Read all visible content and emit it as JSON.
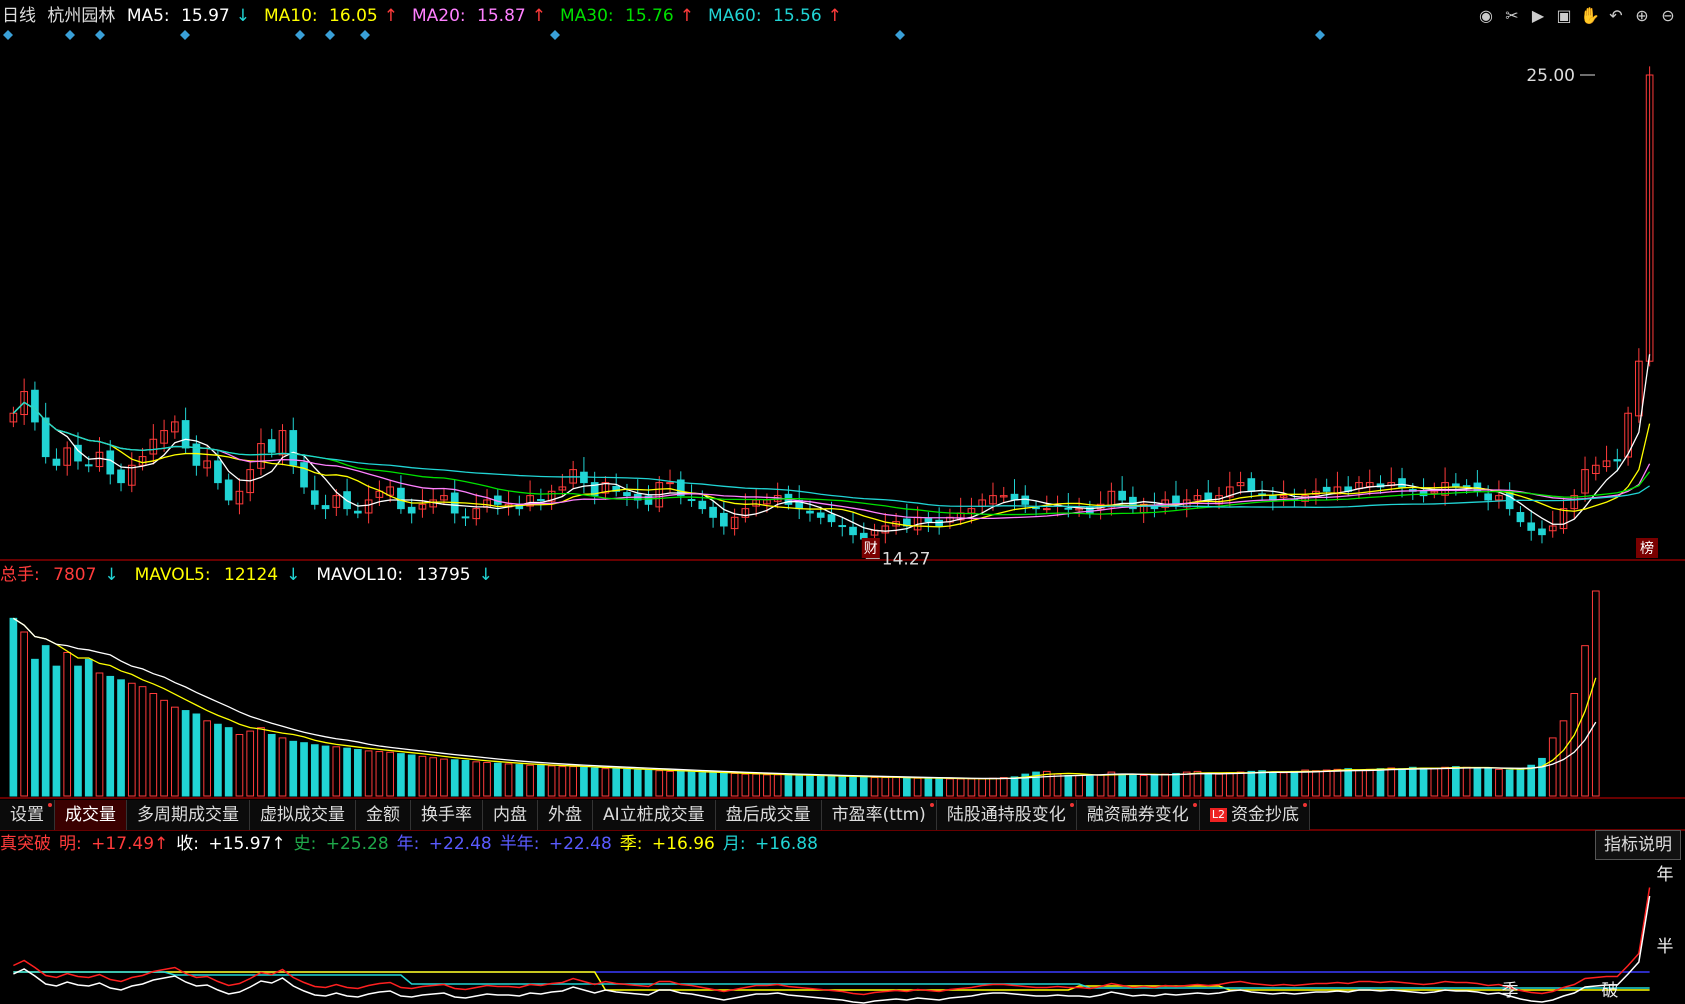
{
  "header": {
    "period": "日线",
    "stock_name": "杭州园林",
    "ma_items": [
      {
        "label": "MA5:",
        "value": "15.97",
        "arrow": "↓",
        "color": "#ffffff",
        "arrow_color": "#21d4d4"
      },
      {
        "label": "MA10:",
        "value": "16.05",
        "arrow": "↑",
        "color": "#ffff00",
        "arrow_color": "#ff3b3b"
      },
      {
        "label": "MA20:",
        "value": "15.87",
        "arrow": "↑",
        "color": "#ff80ff",
        "arrow_color": "#ff3b3b"
      },
      {
        "label": "MA30:",
        "value": "15.76",
        "arrow": "↑",
        "color": "#00e000",
        "arrow_color": "#ff3b3b"
      },
      {
        "label": "MA60:",
        "value": "15.56",
        "arrow": "↑",
        "color": "#21d4d4",
        "arrow_color": "#ff3b3b"
      }
    ]
  },
  "toolbar_icons": [
    "eye-icon",
    "scissors-icon",
    "play-icon",
    "lock-icon",
    "hand-icon",
    "undo-icon",
    "zoom-in-icon",
    "zoom-out-icon"
  ],
  "volume_legend": [
    {
      "label": "总手:",
      "value": "7807",
      "arrow": "↓",
      "color": "#ff3b3b"
    },
    {
      "label": "MAVOL5:",
      "value": "12124",
      "arrow": "↓",
      "color": "#ffff00"
    },
    {
      "label": "MAVOL10:",
      "value": "13795",
      "arrow": "↓",
      "color": "#ffffff"
    }
  ],
  "tabs": [
    {
      "label": "设置",
      "dot": true,
      "active": false
    },
    {
      "label": "成交量",
      "dot": false,
      "active": true
    },
    {
      "label": "多周期成交量",
      "dot": false,
      "active": false
    },
    {
      "label": "虚拟成交量",
      "dot": false,
      "active": false
    },
    {
      "label": "金额",
      "dot": false,
      "active": false
    },
    {
      "label": "换手率",
      "dot": false,
      "active": false
    },
    {
      "label": "内盘",
      "dot": false,
      "active": false
    },
    {
      "label": "外盘",
      "dot": false,
      "active": false
    },
    {
      "label": "AI立桩成交量",
      "dot": false,
      "active": false
    },
    {
      "label": "盘后成交量",
      "dot": false,
      "active": false
    },
    {
      "label": "市盈率(ttm)",
      "dot": true,
      "active": false
    },
    {
      "label": "陆股通持股变化",
      "dot": true,
      "active": false
    },
    {
      "label": "融资融券变化",
      "dot": true,
      "active": false
    },
    {
      "label": "资金抄底",
      "dot": true,
      "active": false,
      "badge": "L2"
    }
  ],
  "indicator_legend": [
    {
      "label": "真突破",
      "value": "",
      "color": "#ff3b3b"
    },
    {
      "label": "明:",
      "value": "+17.49↑",
      "color": "#ff3b3b"
    },
    {
      "label": "收:",
      "value": "+15.97↑",
      "color": "#ffffff"
    },
    {
      "label": "史:",
      "value": "+25.28",
      "color": "#1fa84a"
    },
    {
      "label": "年:",
      "value": "+22.48",
      "color": "#5a5aff"
    },
    {
      "label": "半年:",
      "value": "+22.48",
      "color": "#5a5aff"
    },
    {
      "label": "季:",
      "value": "+16.96",
      "color": "#ffff00"
    },
    {
      "label": "月:",
      "value": "+16.88",
      "color": "#21d4d4"
    }
  ],
  "explain_button": "指标说明",
  "price_annotations": {
    "high_label": "25.00",
    "low_label": "14.27",
    "badge_cai": "财",
    "badge_bang": "榜"
  },
  "indicator_side_labels": {
    "year": "年",
    "half": "半",
    "season": "季",
    "breakout": "破"
  },
  "colors": {
    "up": "#ff3b3b",
    "down": "#21d4d4",
    "ma5": "#ffffff",
    "ma10": "#ffff00",
    "ma20": "#ff80ff",
    "ma30": "#00e000",
    "ma60": "#21d4d4",
    "grid": "#8b0000"
  },
  "chart_data": {
    "type": "candlestick",
    "price_axis_ticks": [
      25.0
    ],
    "low_marker": 14.27,
    "closes": [
      17.2,
      17.7,
      17.0,
      16.2,
      16.0,
      16.4,
      16.1,
      16.0,
      16.3,
      15.8,
      15.6,
      16.0,
      16.2,
      16.6,
      16.8,
      17.0,
      16.4,
      16.0,
      16.1,
      15.6,
      15.2,
      15.4,
      15.9,
      16.5,
      16.3,
      16.8,
      16.0,
      15.5,
      15.1,
      15.0,
      15.3,
      15.0,
      14.9,
      15.2,
      15.4,
      15.5,
      15.0,
      14.9,
      15.1,
      15.2,
      15.3,
      14.9,
      14.8,
      15.0,
      15.2,
      15.1,
      15.1,
      15.0,
      15.3,
      15.2,
      15.4,
      15.5,
      15.9,
      15.6,
      15.3,
      15.6,
      15.4,
      15.3,
      15.2,
      15.1,
      15.6,
      15.6,
      15.3,
      15.2,
      15.0,
      14.8,
      14.6,
      14.8,
      15.0,
      15.2,
      15.2,
      15.3,
      15.1,
      15.0,
      14.9,
      14.8,
      14.7,
      14.6,
      14.4,
      14.3,
      14.5,
      14.6,
      14.7,
      14.6,
      14.8,
      14.7,
      14.6,
      14.8,
      14.9,
      15.0,
      15.2,
      15.3,
      15.3,
      15.2,
      15.1,
      15.0,
      15.0,
      15.1,
      15.0,
      15.0,
      14.9,
      15.1,
      15.4,
      15.2,
      15.0,
      15.1,
      15.0,
      15.2,
      15.1,
      15.2,
      15.3,
      15.2,
      15.3,
      15.5,
      15.6,
      15.4,
      15.3,
      15.2,
      15.3,
      15.2,
      15.3,
      15.4,
      15.4,
      15.5,
      15.4,
      15.6,
      15.6,
      15.5,
      15.6,
      15.5,
      15.4,
      15.3,
      15.4,
      15.6,
      15.5,
      15.5,
      15.4,
      15.2,
      15.3,
      15.0,
      14.7,
      14.5,
      14.4,
      14.6,
      15.0,
      15.3,
      15.9,
      16.0,
      16.1,
      16.1,
      17.2,
      18.4,
      25.0
    ],
    "volumes": [
      26000,
      24000,
      20000,
      22000,
      19000,
      21000,
      19000,
      20000,
      18000,
      17500,
      17000,
      16500,
      16000,
      15000,
      14000,
      13000,
      12500,
      12000,
      11000,
      10500,
      10000,
      9000,
      9500,
      10000,
      9000,
      8500,
      8000,
      7800,
      7500,
      7300,
      7200,
      7000,
      6800,
      6600,
      6500,
      6400,
      6200,
      6000,
      5800,
      5600,
      5400,
      5300,
      5200,
      5000,
      4900,
      4800,
      4700,
      4600,
      4500,
      4500,
      4400,
      4300,
      4300,
      4200,
      4100,
      4000,
      4000,
      3900,
      3800,
      3800,
      3700,
      3600,
      3600,
      3500,
      3400,
      3400,
      3300,
      3300,
      3200,
      3200,
      3100,
      3100,
      3000,
      3000,
      3000,
      2900,
      2900,
      2800,
      2800,
      2800,
      2700,
      2700,
      2700,
      2600,
      2600,
      2600,
      2600,
      2500,
      2500,
      2500,
      2500,
      2600,
      2700,
      2800,
      3200,
      3500,
      3600,
      3200,
      3000,
      3000,
      2900,
      3100,
      3500,
      3200,
      3100,
      3000,
      3100,
      3200,
      3300,
      3500,
      3600,
      3300,
      3200,
      3400,
      3500,
      3600,
      3700,
      3500,
      3400,
      3600,
      3800,
      3700,
      3800,
      3900,
      4000,
      3800,
      3900,
      4000,
      4100,
      4000,
      4200,
      4100,
      4000,
      4200,
      4300,
      4200,
      4100,
      4000,
      3900,
      3800,
      3900,
      4500,
      5500,
      8500,
      11000,
      15000,
      22000,
      30000
    ]
  }
}
